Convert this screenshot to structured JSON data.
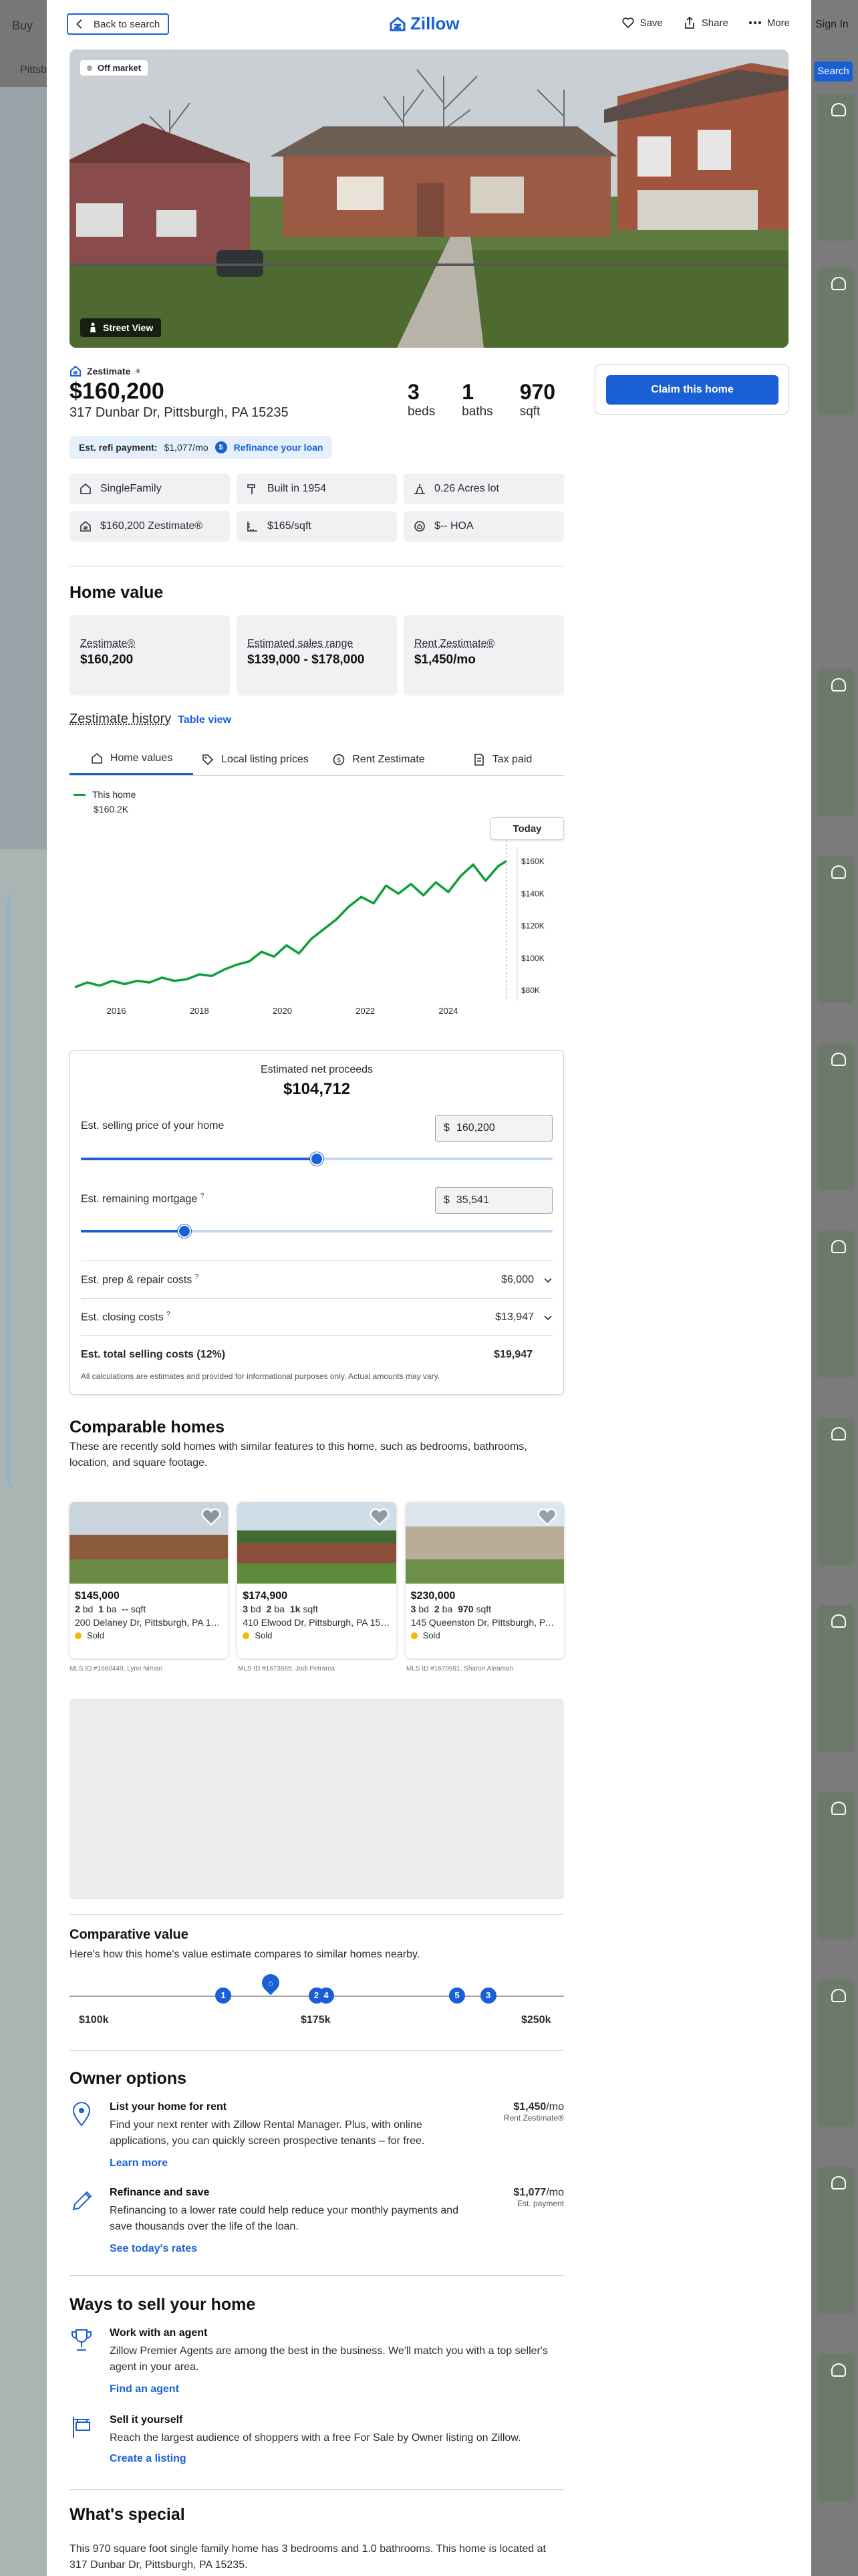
{
  "background": {
    "nav_buy": "Buy",
    "nav_sign_in": "Sign In",
    "search_location": "Pittsb",
    "search_button": "Search"
  },
  "topbar": {
    "back_label": "Back to search",
    "logo_text": "Zillow",
    "save_label": "Save",
    "share_label": "Share",
    "more_label": "More"
  },
  "hero": {
    "badge": "Off market",
    "street_view": "Street View"
  },
  "summary": {
    "zestimate_label": "Zestimate",
    "price": "$160,200",
    "address": "317 Dunbar Dr, Pittsburgh, PA 15235",
    "beds": "3",
    "beds_label": "beds",
    "baths": "1",
    "baths_label": "baths",
    "sqft": "970",
    "sqft_label": "sqft",
    "refi_label": "Est. refi payment:",
    "refi_value": "$1,077/mo",
    "refi_link": "Refinance your loan",
    "claim_button": "Claim this home"
  },
  "facts": [
    {
      "icon": "house-icon",
      "text": "SingleFamily"
    },
    {
      "icon": "hammer-icon",
      "text": "Built in 1954"
    },
    {
      "icon": "lot-icon",
      "text": "0.26 Acres lot"
    },
    {
      "icon": "zestimate-icon",
      "text": "$160,200 Zestimate®"
    },
    {
      "icon": "ruler-icon",
      "text": "$165/sqft"
    },
    {
      "icon": "hoa-icon",
      "text": "$-- HOA"
    }
  ],
  "home_value": {
    "title": "Home value",
    "cards": [
      {
        "label": "Zestimate®",
        "value": "$160,200"
      },
      {
        "label": "Estimated sales range",
        "value": "$139,000 - $178,000"
      },
      {
        "label": "Rent Zestimate®",
        "value": "$1,450/mo"
      }
    ]
  },
  "history": {
    "title": "Zestimate history",
    "table_link": "Table view",
    "tabs": [
      {
        "label": "Home values",
        "icon": "house-icon"
      },
      {
        "label": "Local listing prices",
        "icon": "tag-icon"
      },
      {
        "label": "Rent Zestimate",
        "icon": "dollar-circle-icon"
      },
      {
        "label": "Tax paid",
        "icon": "document-icon"
      }
    ],
    "legend_name": "This home",
    "legend_value": "$160.2K",
    "today_label": "Today"
  },
  "chart_data": {
    "type": "line",
    "title": "",
    "xlabel": "",
    "ylabel": "",
    "x_ticks": [
      "2016",
      "2018",
      "2020",
      "2022",
      "2024"
    ],
    "y_ticks": [
      "$80K",
      "$100K",
      "$120K",
      "$140K",
      "$160K"
    ],
    "ylim": [
      78,
      165
    ],
    "xlim": [
      2015.0,
      2025.5
    ],
    "grid": false,
    "legend": "top-left",
    "color": "#0f9e3a",
    "series": [
      {
        "name": "This home",
        "x": [
          2015.0,
          2015.3,
          2015.6,
          2015.9,
          2016.2,
          2016.5,
          2016.8,
          2017.1,
          2017.4,
          2017.7,
          2018.0,
          2018.3,
          2018.6,
          2018.9,
          2019.2,
          2019.5,
          2019.8,
          2020.1,
          2020.4,
          2020.7,
          2021.0,
          2021.3,
          2021.6,
          2021.9,
          2022.2,
          2022.5,
          2022.8,
          2023.1,
          2023.4,
          2023.7,
          2024.0,
          2024.3,
          2024.6,
          2024.9,
          2025.2,
          2025.4
        ],
        "y": [
          82,
          85,
          83,
          86,
          84,
          86,
          85,
          88,
          86,
          87,
          90,
          89,
          93,
          96,
          98,
          104,
          101,
          108,
          103,
          112,
          118,
          124,
          132,
          138,
          134,
          145,
          140,
          146,
          139,
          147,
          141,
          151,
          158,
          148,
          157,
          160.2
        ]
      }
    ]
  },
  "proceeds": {
    "label": "Estimated net proceeds",
    "value": "$104,712",
    "price_label": "Est. selling price of your home",
    "price_value": "160,200",
    "price_fraction": 0.5,
    "mortgage_label": "Est. remaining mortgage",
    "mortgage_value": "35,541",
    "mortgage_fraction": 0.22,
    "currency": "$",
    "costs": [
      {
        "label": "Est. prep & repair costs",
        "value": "$6,000"
      },
      {
        "label": "Est. closing costs",
        "value": "$13,947"
      }
    ],
    "total_label": "Est. total selling costs (12%)",
    "total_value": "$19,947",
    "disclaimer": "All calculations are estimates and provided for informational purposes only. Actual amounts may vary."
  },
  "comparables": {
    "title": "Comparable homes",
    "subtitle": "These are recently sold homes with similar features to this home, such as bedrooms, bathrooms, location, and square footage.",
    "items": [
      {
        "price": "$145,000",
        "beds": "2",
        "baths": "1",
        "sqft": "--",
        "address": "200 Delaney Dr, Pittsburgh, PA 15235",
        "status": "Sold",
        "mls": "MLS ID #1660449, Lynn Niman"
      },
      {
        "price": "$174,900",
        "beds": "3",
        "baths": "2",
        "sqft": "1k",
        "address": "410 Elwood Dr, Pittsburgh, PA 15235",
        "status": "Sold",
        "mls": "MLS ID #1673965, Jodi Petrarca"
      },
      {
        "price": "$230,000",
        "beds": "3",
        "baths": "2",
        "sqft": "970",
        "address": "145 Queenston Dr, Pittsburgh, PA 15235",
        "status": "Sold",
        "mls": "MLS ID #1670991, Sharon Aleaman"
      }
    ],
    "bd": "bd",
    "ba": "ba",
    "sqft": "sqft"
  },
  "comparative_value": {
    "title": "Comparative value",
    "subtitle": "Here's how this home's value estimate compares to similar homes nearby.",
    "markers": [
      {
        "label": "1",
        "value": 145
      },
      {
        "label": "2",
        "value": 174.9
      },
      {
        "label": "4",
        "value": 178
      },
      {
        "label": "5",
        "value": 220
      },
      {
        "label": "3",
        "value": 230
      }
    ],
    "home_value": 160.2,
    "range": [
      100,
      250
    ],
    "axis_labels": [
      "$100k",
      "$175k",
      "$250k"
    ]
  },
  "owner_options": {
    "title": "Owner options",
    "items": [
      {
        "title": "List your home for rent",
        "desc": "Find your next renter with Zillow Rental Manager. Plus, with online applications, you can quickly screen prospective tenants – for free.",
        "link": "Learn more",
        "value": "$1,450",
        "value_unit": "/mo",
        "sub": "Rent Zestimate®"
      },
      {
        "title": "Refinance and save",
        "desc": "Refinancing to a lower rate could help reduce your monthly payments and save thousands over the life of the loan.",
        "link": "See today's rates",
        "value": "$1,077",
        "value_unit": "/mo",
        "sub": "Est. payment"
      }
    ]
  },
  "ways_to_sell": {
    "title": "Ways to sell your home",
    "items": [
      {
        "title": "Work with an agent",
        "desc": "Zillow Premier Agents are among the best in the business. We'll match you with a top seller's agent in your area.",
        "link": "Find an agent"
      },
      {
        "title": "Sell it yourself",
        "desc": "Reach the largest audience of shoppers with a free For Sale by Owner listing on Zillow.",
        "link": "Create a listing"
      }
    ]
  },
  "special": {
    "title": "What's special",
    "text": "This 970 square foot single family home has 3 bedrooms and 1.0 bathrooms. This home is located at 317 Dunbar Dr, Pittsburgh, PA 15235."
  }
}
